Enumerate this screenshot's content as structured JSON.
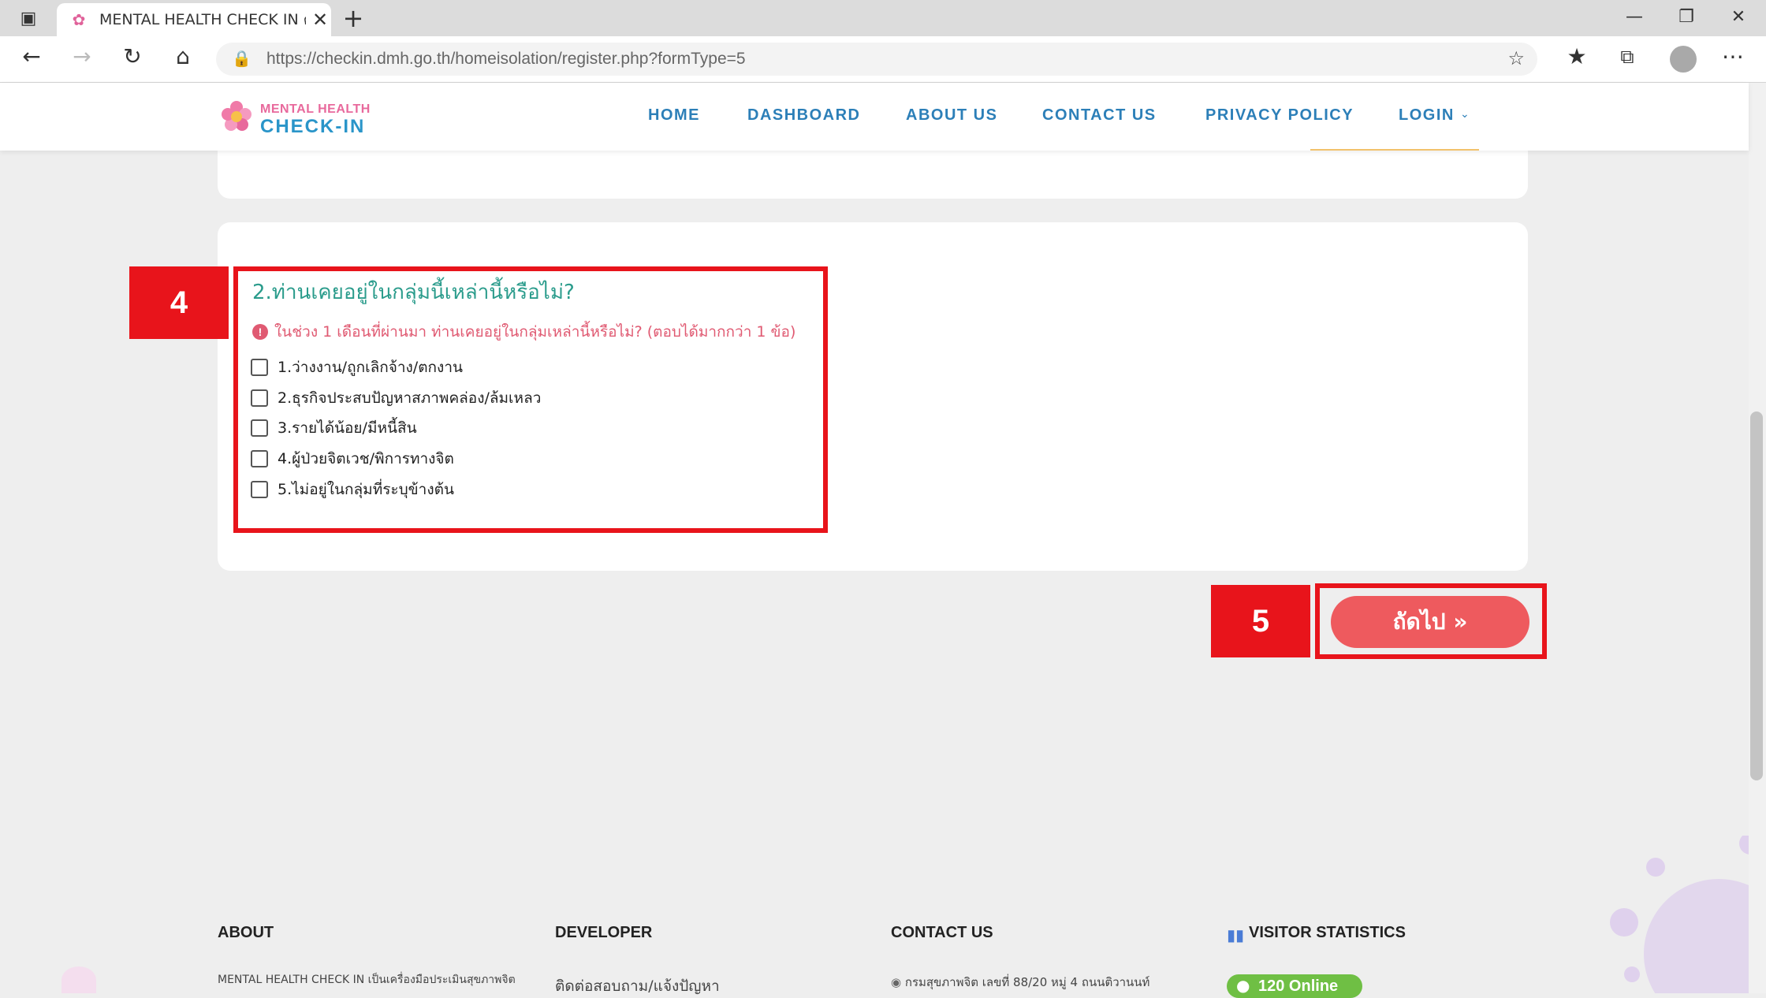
{
  "browser": {
    "tab_title": "MENTAL HEALTH CHECK IN ตรวจ",
    "url": "https://checkin.dmh.go.th/homeisolation/register.php?formType=5",
    "colors": {
      "tabbar": "#dcdcdc"
    }
  },
  "site_nav": {
    "logo_line1": "MENTAL HEALTH",
    "logo_line2": "CHECK-IN",
    "links": [
      "HOME",
      "DASHBOARD",
      "ABOUT US",
      "CONTACT US",
      "PRIVACY POLICY",
      "LOGIN"
    ]
  },
  "question": {
    "title": "2.ท่านเคยอยู่ในกลุ่มนี้เหล่านี้หรือไม่?",
    "hint": "ในช่วง 1 เดือนที่ผ่านมา ท่านเคยอยู่ในกลุ่มเหล่านี้หรือไม่? (ตอบได้มากกว่า 1 ข้อ)",
    "options": [
      "1.ว่างงาน/ถูกเลิกจ้าง/ตกงาน",
      "2.ธุรกิจประสบปัญหาสภาพคล่อง/ล้มเหลว",
      "3.รายได้น้อย/มีหนี้สิน",
      "4.ผู้ป่วยจิตเวช/พิการทางจิต",
      "5.ไม่อยู่ในกลุ่มที่ระบุข้างต้น"
    ]
  },
  "annotations": {
    "badge_question": "4",
    "badge_next": "5",
    "color": "#e8141b"
  },
  "next_button": {
    "label": "ถัดไป »"
  },
  "footer": {
    "about_heading": "ABOUT",
    "about_text": "MENTAL HEALTH CHECK IN เป็นเครื่องมือประเมินสุขภาพจิต",
    "developer_heading": "DEVELOPER",
    "developer_text": "ติดต่อสอบถาม/แจ้งปัญหา",
    "contact_heading": "CONTACT US",
    "contact_text": "กรมสุขภาพจิต เลขที่ 88/20 หมู่ 4 ถนนติวานนท์",
    "stats_heading": "VISITOR STATISTICS",
    "online": "120 Online"
  }
}
